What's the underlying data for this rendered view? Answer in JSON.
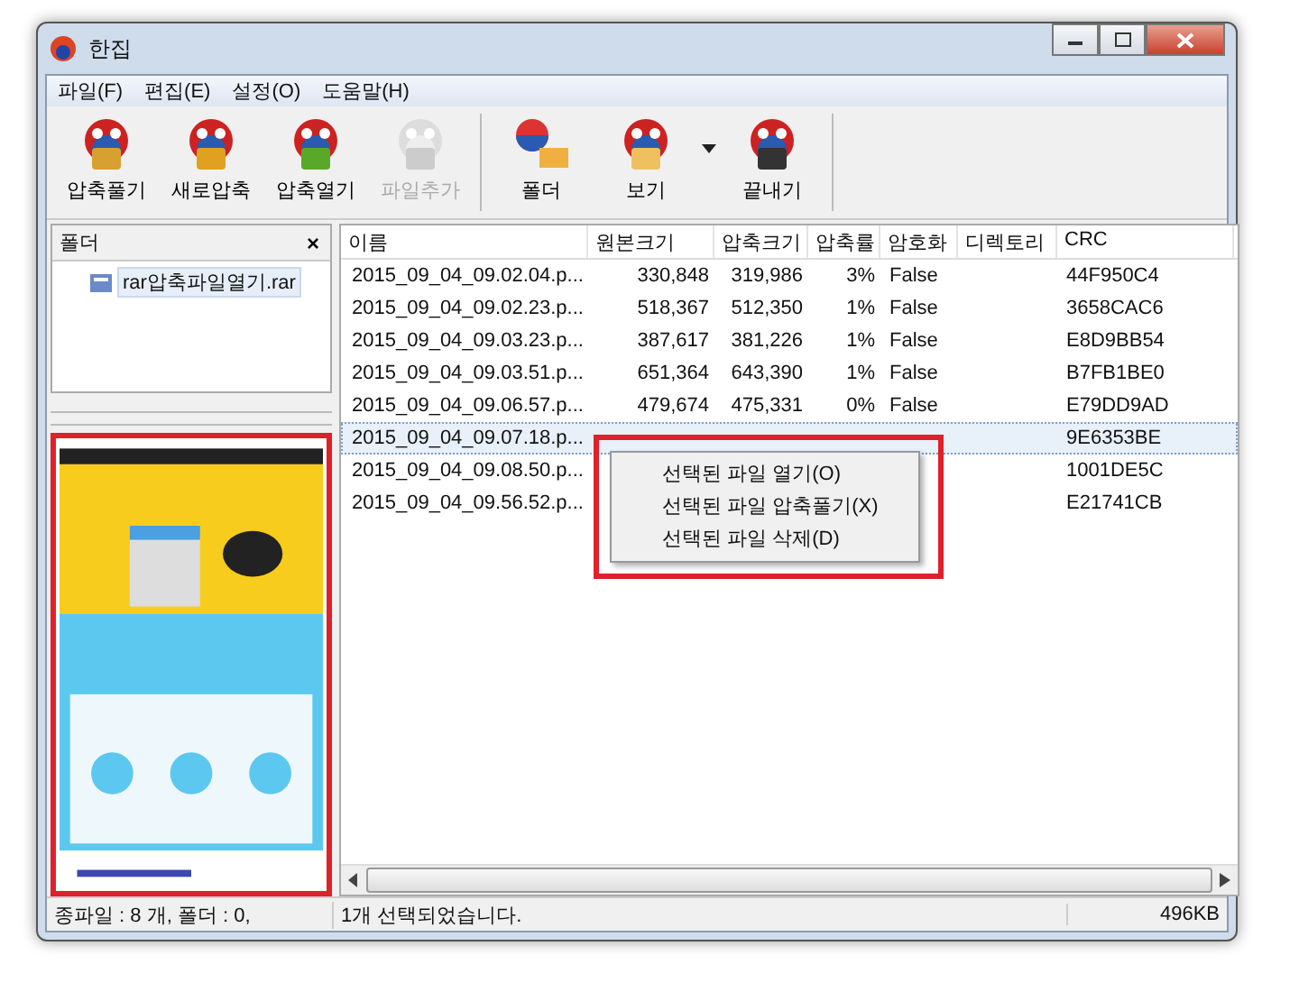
{
  "window": {
    "title": "한집"
  },
  "menu": [
    "파일(F)",
    "편집(E)",
    "설정(O)",
    "도움말(H)"
  ],
  "toolbar": {
    "groups": [
      [
        {
          "label": "압축풀기",
          "kind": "extract",
          "disabled": false,
          "dropdown": false
        },
        {
          "label": "새로압축",
          "kind": "new",
          "disabled": false,
          "dropdown": false
        },
        {
          "label": "압축열기",
          "kind": "open",
          "disabled": false,
          "dropdown": false
        },
        {
          "label": "파일추가",
          "kind": "add",
          "disabled": true,
          "dropdown": false
        }
      ],
      [
        {
          "label": "폴더",
          "kind": "folder",
          "disabled": false,
          "dropdown": false
        },
        {
          "label": "보기",
          "kind": "view",
          "disabled": false,
          "dropdown": true
        },
        {
          "label": "끝내기",
          "kind": "exit",
          "disabled": false,
          "dropdown": false
        }
      ]
    ]
  },
  "folder_pane": {
    "title": "폴더",
    "close": "×",
    "items": [
      {
        "label": "rar압축파일열기.rar",
        "selected": true
      }
    ]
  },
  "table": {
    "columns": [
      "이름",
      "원본크기",
      "압축크기",
      "압축률",
      "암호화",
      "디렉토리",
      "CRC"
    ],
    "rows": [
      {
        "cells": [
          "2015_09_04_09.02.04.p...",
          "330,848",
          "319,986",
          "3%",
          "False",
          "",
          "44F950C4"
        ],
        "selected": false
      },
      {
        "cells": [
          "2015_09_04_09.02.23.p...",
          "518,367",
          "512,350",
          "1%",
          "False",
          "",
          "3658CAC6"
        ],
        "selected": false
      },
      {
        "cells": [
          "2015_09_04_09.03.23.p...",
          "387,617",
          "381,226",
          "1%",
          "False",
          "",
          "E8D9BB54"
        ],
        "selected": false
      },
      {
        "cells": [
          "2015_09_04_09.03.51.p...",
          "651,364",
          "643,390",
          "1%",
          "False",
          "",
          "B7FB1BE0"
        ],
        "selected": false
      },
      {
        "cells": [
          "2015_09_04_09.06.57.p...",
          "479,674",
          "475,331",
          "0%",
          "False",
          "",
          "E79DD9AD"
        ],
        "selected": false
      },
      {
        "cells": [
          "2015_09_04_09.07.18.p...",
          "",
          "",
          "",
          "",
          "",
          "9E6353BE"
        ],
        "selected": true
      },
      {
        "cells": [
          "2015_09_04_09.08.50.p...",
          "",
          "",
          "",
          "",
          "",
          "1001DE5C"
        ],
        "selected": false
      },
      {
        "cells": [
          "2015_09_04_09.56.52.p...",
          "",
          "",
          "",
          "",
          "",
          "E21741CB"
        ],
        "selected": false
      }
    ]
  },
  "context_menu": {
    "items": [
      "선택된 파일 열기(O)",
      "선택된 파일 압축풀기(X)",
      "선택된 파일 삭제(D)"
    ]
  },
  "status_bar": [
    "종파일 : 8 개, 폴더 : 0,",
    "1개 선택되었습니다.",
    "496KB"
  ]
}
